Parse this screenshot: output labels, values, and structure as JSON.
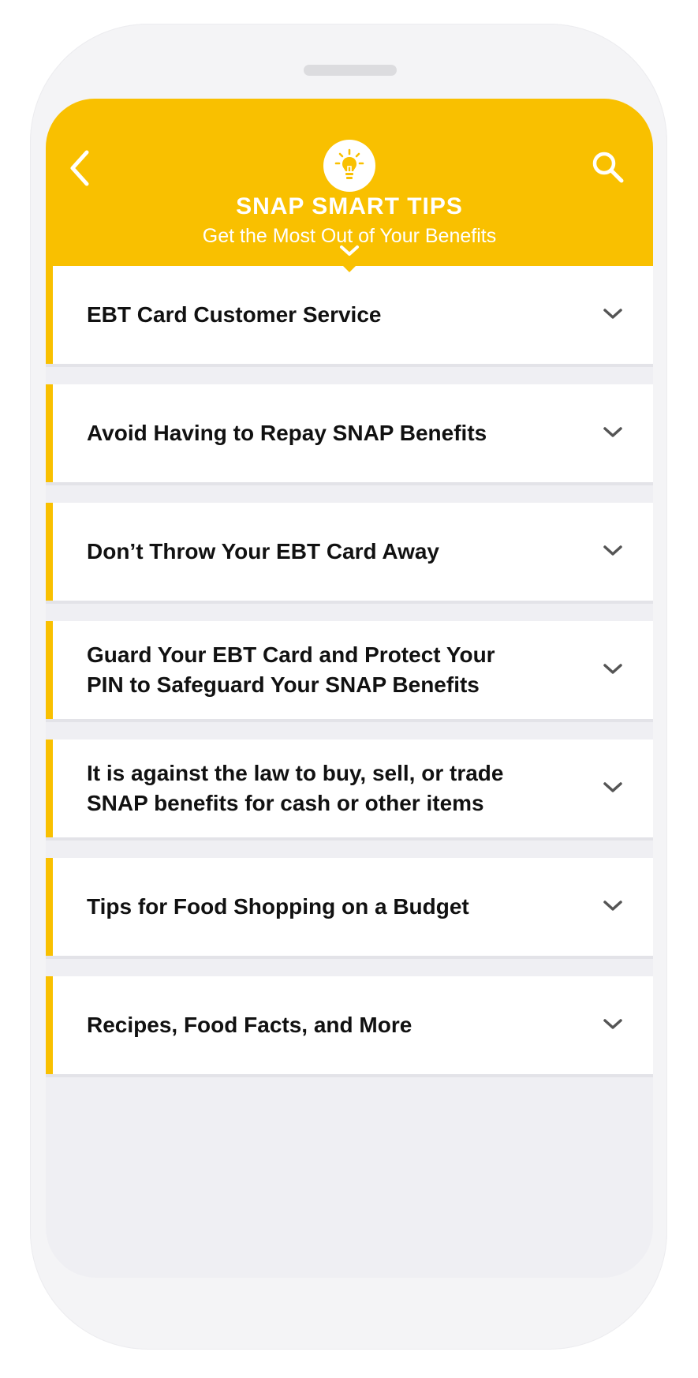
{
  "header": {
    "title": "SNAP SMART TIPS",
    "subtitle": "Get the Most Out of  Your Benefits",
    "icons": {
      "back": "chevron-left-icon",
      "search": "search-icon",
      "badge": "lightbulb-icon",
      "expand": "chevron-down-icon"
    }
  },
  "tips": {
    "items": [
      {
        "label": "EBT Card Customer Service"
      },
      {
        "label": "Avoid Having to Repay SNAP Benefits"
      },
      {
        "label": "Don’t Throw Your EBT Card Away"
      },
      {
        "label": "Guard Your EBT Card and Protect Your PIN to Safeguard Your SNAP Benefits"
      },
      {
        "label": "It is against the law to buy, sell, or trade SNAP benefits for cash or other items"
      },
      {
        "label": "Tips for Food Shopping on a Budget"
      },
      {
        "label": "Recipes, Food Facts, and More"
      }
    ]
  },
  "colors": {
    "accent": "#f9c000",
    "text": "#111111",
    "chevron": "#555555",
    "background": "#efeff3"
  }
}
